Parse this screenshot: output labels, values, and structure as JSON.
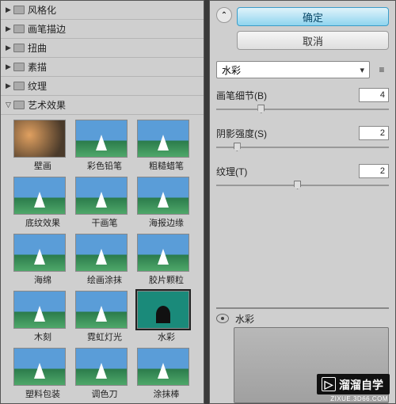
{
  "tree": {
    "items": [
      {
        "label": "风格化",
        "expanded": false
      },
      {
        "label": "画笔描边",
        "expanded": false
      },
      {
        "label": "扭曲",
        "expanded": false
      },
      {
        "label": "素描",
        "expanded": false
      },
      {
        "label": "纹理",
        "expanded": false
      },
      {
        "label": "艺术效果",
        "expanded": true
      }
    ]
  },
  "thumbs": [
    {
      "label": "壁画",
      "variant": "bihua"
    },
    {
      "label": "彩色铅笔",
      "variant": "std"
    },
    {
      "label": "粗糙蜡笔",
      "variant": "std"
    },
    {
      "label": "底纹效果",
      "variant": "std"
    },
    {
      "label": "干画笔",
      "variant": "std"
    },
    {
      "label": "海报边缘",
      "variant": "std"
    },
    {
      "label": "海绵",
      "variant": "std"
    },
    {
      "label": "绘画涂抹",
      "variant": "std"
    },
    {
      "label": "胶片颗粒",
      "variant": "std"
    },
    {
      "label": "木刻",
      "variant": "std"
    },
    {
      "label": "霓虹灯光",
      "variant": "std"
    },
    {
      "label": "水彩",
      "variant": "shuicai",
      "selected": true
    },
    {
      "label": "塑料包装",
      "variant": "std"
    },
    {
      "label": "调色刀",
      "variant": "std"
    },
    {
      "label": "涂抹棒",
      "variant": "std"
    }
  ],
  "buttons": {
    "ok": "确定",
    "cancel": "取消"
  },
  "filter_select": "水彩",
  "sliders": [
    {
      "label": "画笔细节(B)",
      "value": "4",
      "pos": 24
    },
    {
      "label": "阴影强度(S)",
      "value": "2",
      "pos": 10
    },
    {
      "label": "纹理(T)",
      "value": "2",
      "pos": 45
    }
  ],
  "preview_label": "水彩",
  "logo": {
    "main": "溜溜自学",
    "sub": "ZIXUE.3D66.COM"
  }
}
